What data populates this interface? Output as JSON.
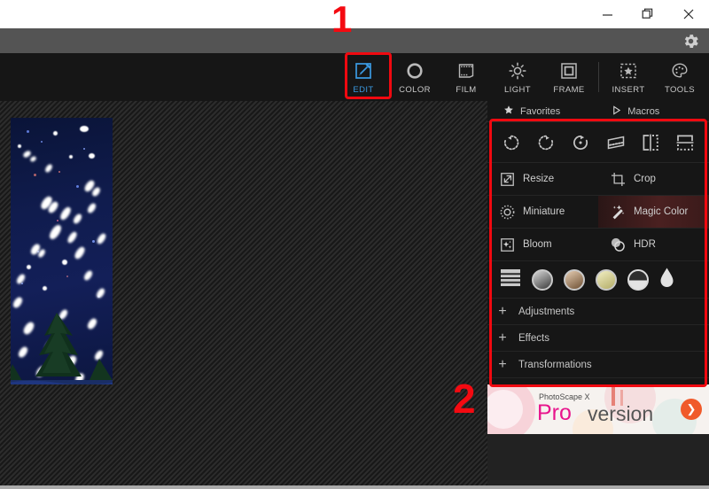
{
  "window": {
    "controls": [
      {
        "name": "minimize",
        "glyph": "minimize-icon"
      },
      {
        "name": "maximize",
        "glyph": "maximize-icon"
      },
      {
        "name": "close",
        "glyph": "close-icon"
      }
    ],
    "settings_icon": "gear-icon"
  },
  "menubar": {
    "items": [
      {
        "label": "EDIT",
        "icon": "edit-pencil-square-icon",
        "active": true
      },
      {
        "label": "COLOR",
        "icon": "color-circle-icon",
        "active": false
      },
      {
        "label": "FILM",
        "icon": "film-frame-icon",
        "active": false
      },
      {
        "label": "LIGHT",
        "icon": "light-sun-icon",
        "active": false
      },
      {
        "label": "FRAME",
        "icon": "frame-square-icon",
        "active": false
      },
      {
        "label": "INSERT",
        "icon": "insert-star-icon",
        "active": false
      },
      {
        "label": "TOOLS",
        "icon": "tools-palette-icon",
        "active": false
      }
    ]
  },
  "annotations": {
    "step1": "1",
    "step2": "2",
    "highlight_color": "#f00910"
  },
  "panel": {
    "tabs": [
      {
        "label": "Favorites",
        "icon": "star-icon"
      },
      {
        "label": "Macros",
        "icon": "play-triangle-icon"
      }
    ],
    "rotate_tools": [
      {
        "name": "rotate-left-icon"
      },
      {
        "name": "rotate-right-icon"
      },
      {
        "name": "free-rotate-icon"
      },
      {
        "name": "perspective-icon"
      },
      {
        "name": "flip-horizontal-icon"
      },
      {
        "name": "flip-vertical-icon"
      }
    ],
    "features": [
      {
        "label": "Resize",
        "icon": "resize-arrow-icon",
        "highlighted": false
      },
      {
        "label": "Crop",
        "icon": "crop-icon",
        "highlighted": false
      },
      {
        "label": "Miniature",
        "icon": "miniature-icon",
        "highlighted": false
      },
      {
        "label": "Magic Color",
        "icon": "magic-wand-icon",
        "highlighted": true
      },
      {
        "label": "Bloom",
        "icon": "bloom-sparkle-icon",
        "highlighted": false
      },
      {
        "label": "HDR",
        "icon": "hdr-circles-icon",
        "highlighted": false
      }
    ],
    "swatches": [
      {
        "name": "film-strip-icon",
        "color": "#c9c9c9"
      },
      {
        "name": "grayscale-swatch",
        "color": "#8c8c8c"
      },
      {
        "name": "sepia-swatch",
        "color": "#b08765"
      },
      {
        "name": "vintage-swatch",
        "color": "#cfc98f"
      },
      {
        "name": "vignette-swatch",
        "color": "#d5d5d5"
      },
      {
        "name": "water-drop-icon",
        "color": "#e2e2e2"
      }
    ],
    "accordions": [
      {
        "label": "Adjustments",
        "expander": "+"
      },
      {
        "label": "Effects",
        "expander": "+"
      },
      {
        "label": "Transformations",
        "expander": "+"
      }
    ]
  },
  "ad": {
    "brand": "PhotoScape X",
    "pro": "Pro",
    "version": "version",
    "arrow": "❯"
  }
}
